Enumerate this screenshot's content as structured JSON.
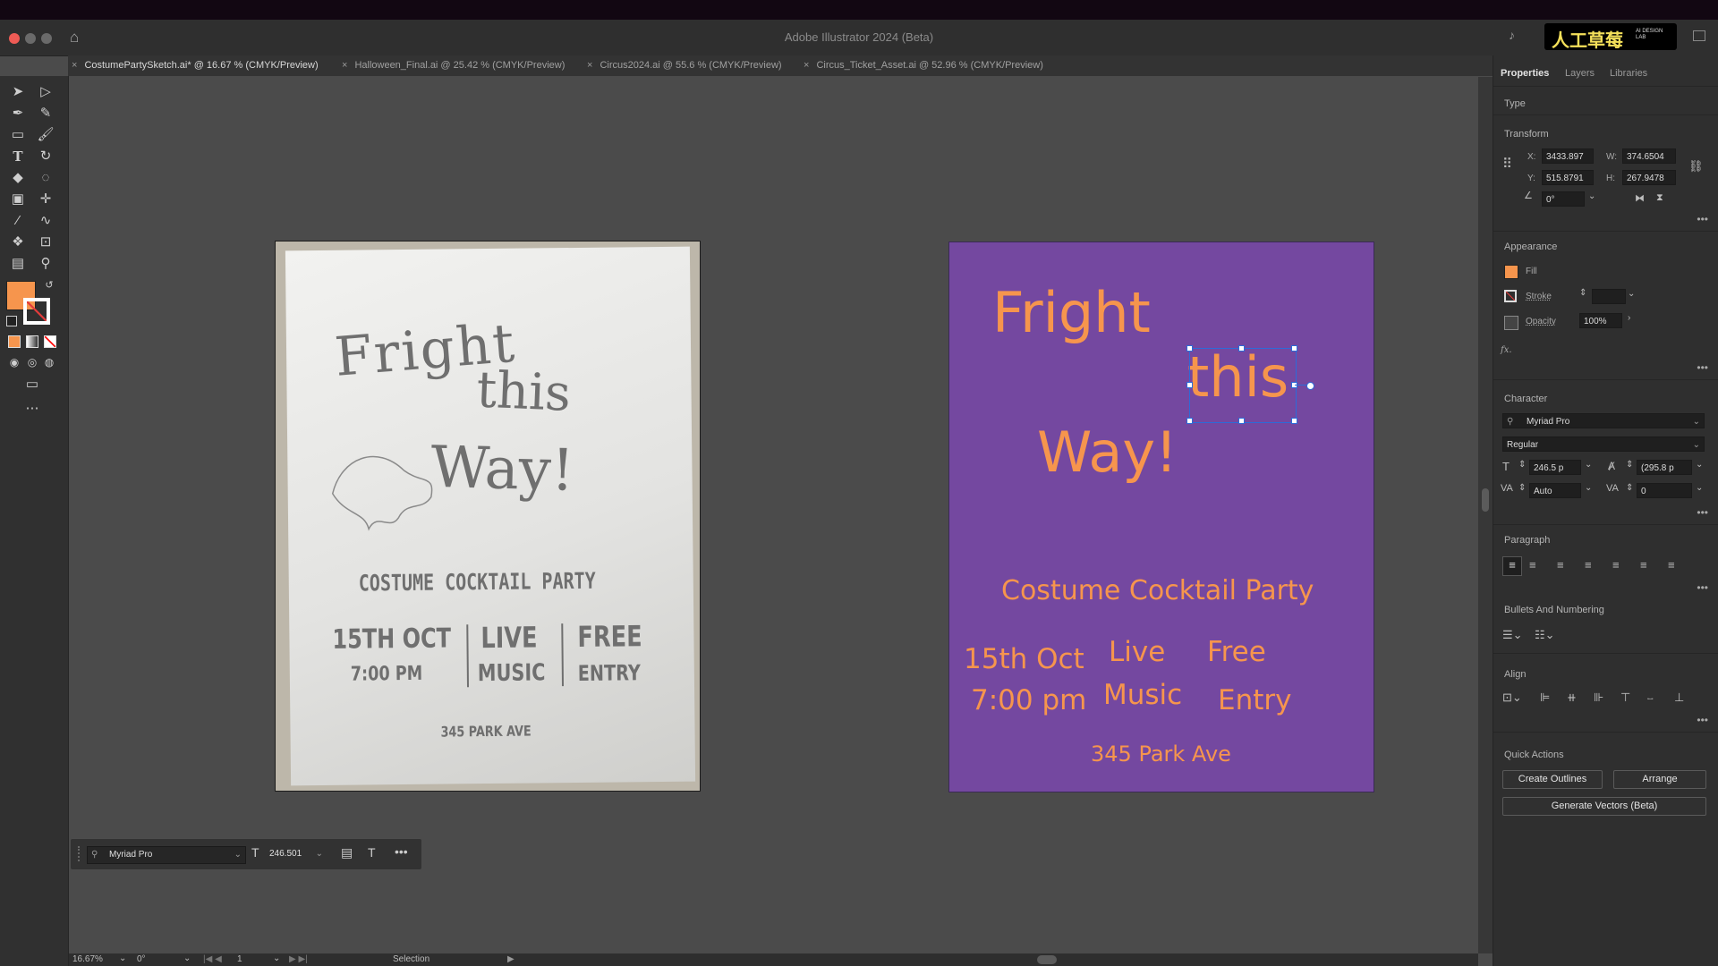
{
  "app": {
    "title": "Adobe Illustrator 2024 (Beta)",
    "watermark": "人工草莓",
    "watermark_sub": "AI DESIGN LAB"
  },
  "tabs": [
    {
      "label": "CostumePartySketch.ai* @ 16.67 % (CMYK/Preview)",
      "active": true
    },
    {
      "label": "Halloween_Final.ai @ 25.42 % (CMYK/Preview)",
      "active": false
    },
    {
      "label": "Circus2024.ai @ 55.6 % (CMYK/Preview)",
      "active": false
    },
    {
      "label": "Circus_Ticket_Asset.ai @ 52.96 % (CMYK/Preview)",
      "active": false
    }
  ],
  "sketch": {
    "line1": "Fright",
    "line2": "this",
    "line3": "Way!",
    "subtitle": "COSTUME COCKTAIL PARTY",
    "col1a": "15TH OCT",
    "col1b": "7:00 PM",
    "col2a": "LIVE",
    "col2b": "MUSIC",
    "col3a": "FREE",
    "col3b": "ENTRY",
    "address": "345 PARK AVE"
  },
  "artboard": {
    "line1": "Fright",
    "line2": "this",
    "line3": "Way!",
    "subtitle": "Costume Cocktail Party",
    "col1a": "15th Oct",
    "col1b": "7:00 pm",
    "col2a": "Live",
    "col2b": "Music",
    "col3a": "Free",
    "col3b": "Entry",
    "address": "345 Park Ave",
    "text_color": "#f6954d",
    "bg_color": "#7448a0"
  },
  "panel": {
    "tabs": [
      "Properties",
      "Layers",
      "Libraries"
    ],
    "type_label": "Type",
    "transform": {
      "title": "Transform",
      "x_label": "X:",
      "x": "3433.897",
      "w_label": "W:",
      "w": "374.6504",
      "y_label": "Y:",
      "y": "515.8791",
      "h_label": "H:",
      "h": "267.9478",
      "angle": "0°"
    },
    "appearance": {
      "title": "Appearance",
      "fill": "Fill",
      "stroke": "Stroke",
      "opacity": "Opacity",
      "opacity_value": "100%",
      "fx": "fx."
    },
    "character": {
      "title": "Character",
      "font": "Myriad Pro",
      "style": "Regular",
      "size": "246.5 p",
      "leading": "(295.8 p",
      "kerning": "Auto",
      "tracking": "0"
    },
    "paragraph": {
      "title": "Paragraph"
    },
    "bullets": {
      "title": "Bullets And Numbering"
    },
    "align": {
      "title": "Align"
    },
    "quick": {
      "title": "Quick Actions",
      "outlines": "Create Outlines",
      "arrange": "Arrange",
      "generate": "Generate Vectors (Beta)"
    }
  },
  "context_bar": {
    "font": "Myriad Pro",
    "size": "246.501"
  },
  "status": {
    "zoom": "16.67%",
    "rotation": "0°",
    "page": "1",
    "tool": "Selection"
  },
  "colors": {
    "fill": "#f6954d",
    "accent": "#2d6bd8"
  }
}
